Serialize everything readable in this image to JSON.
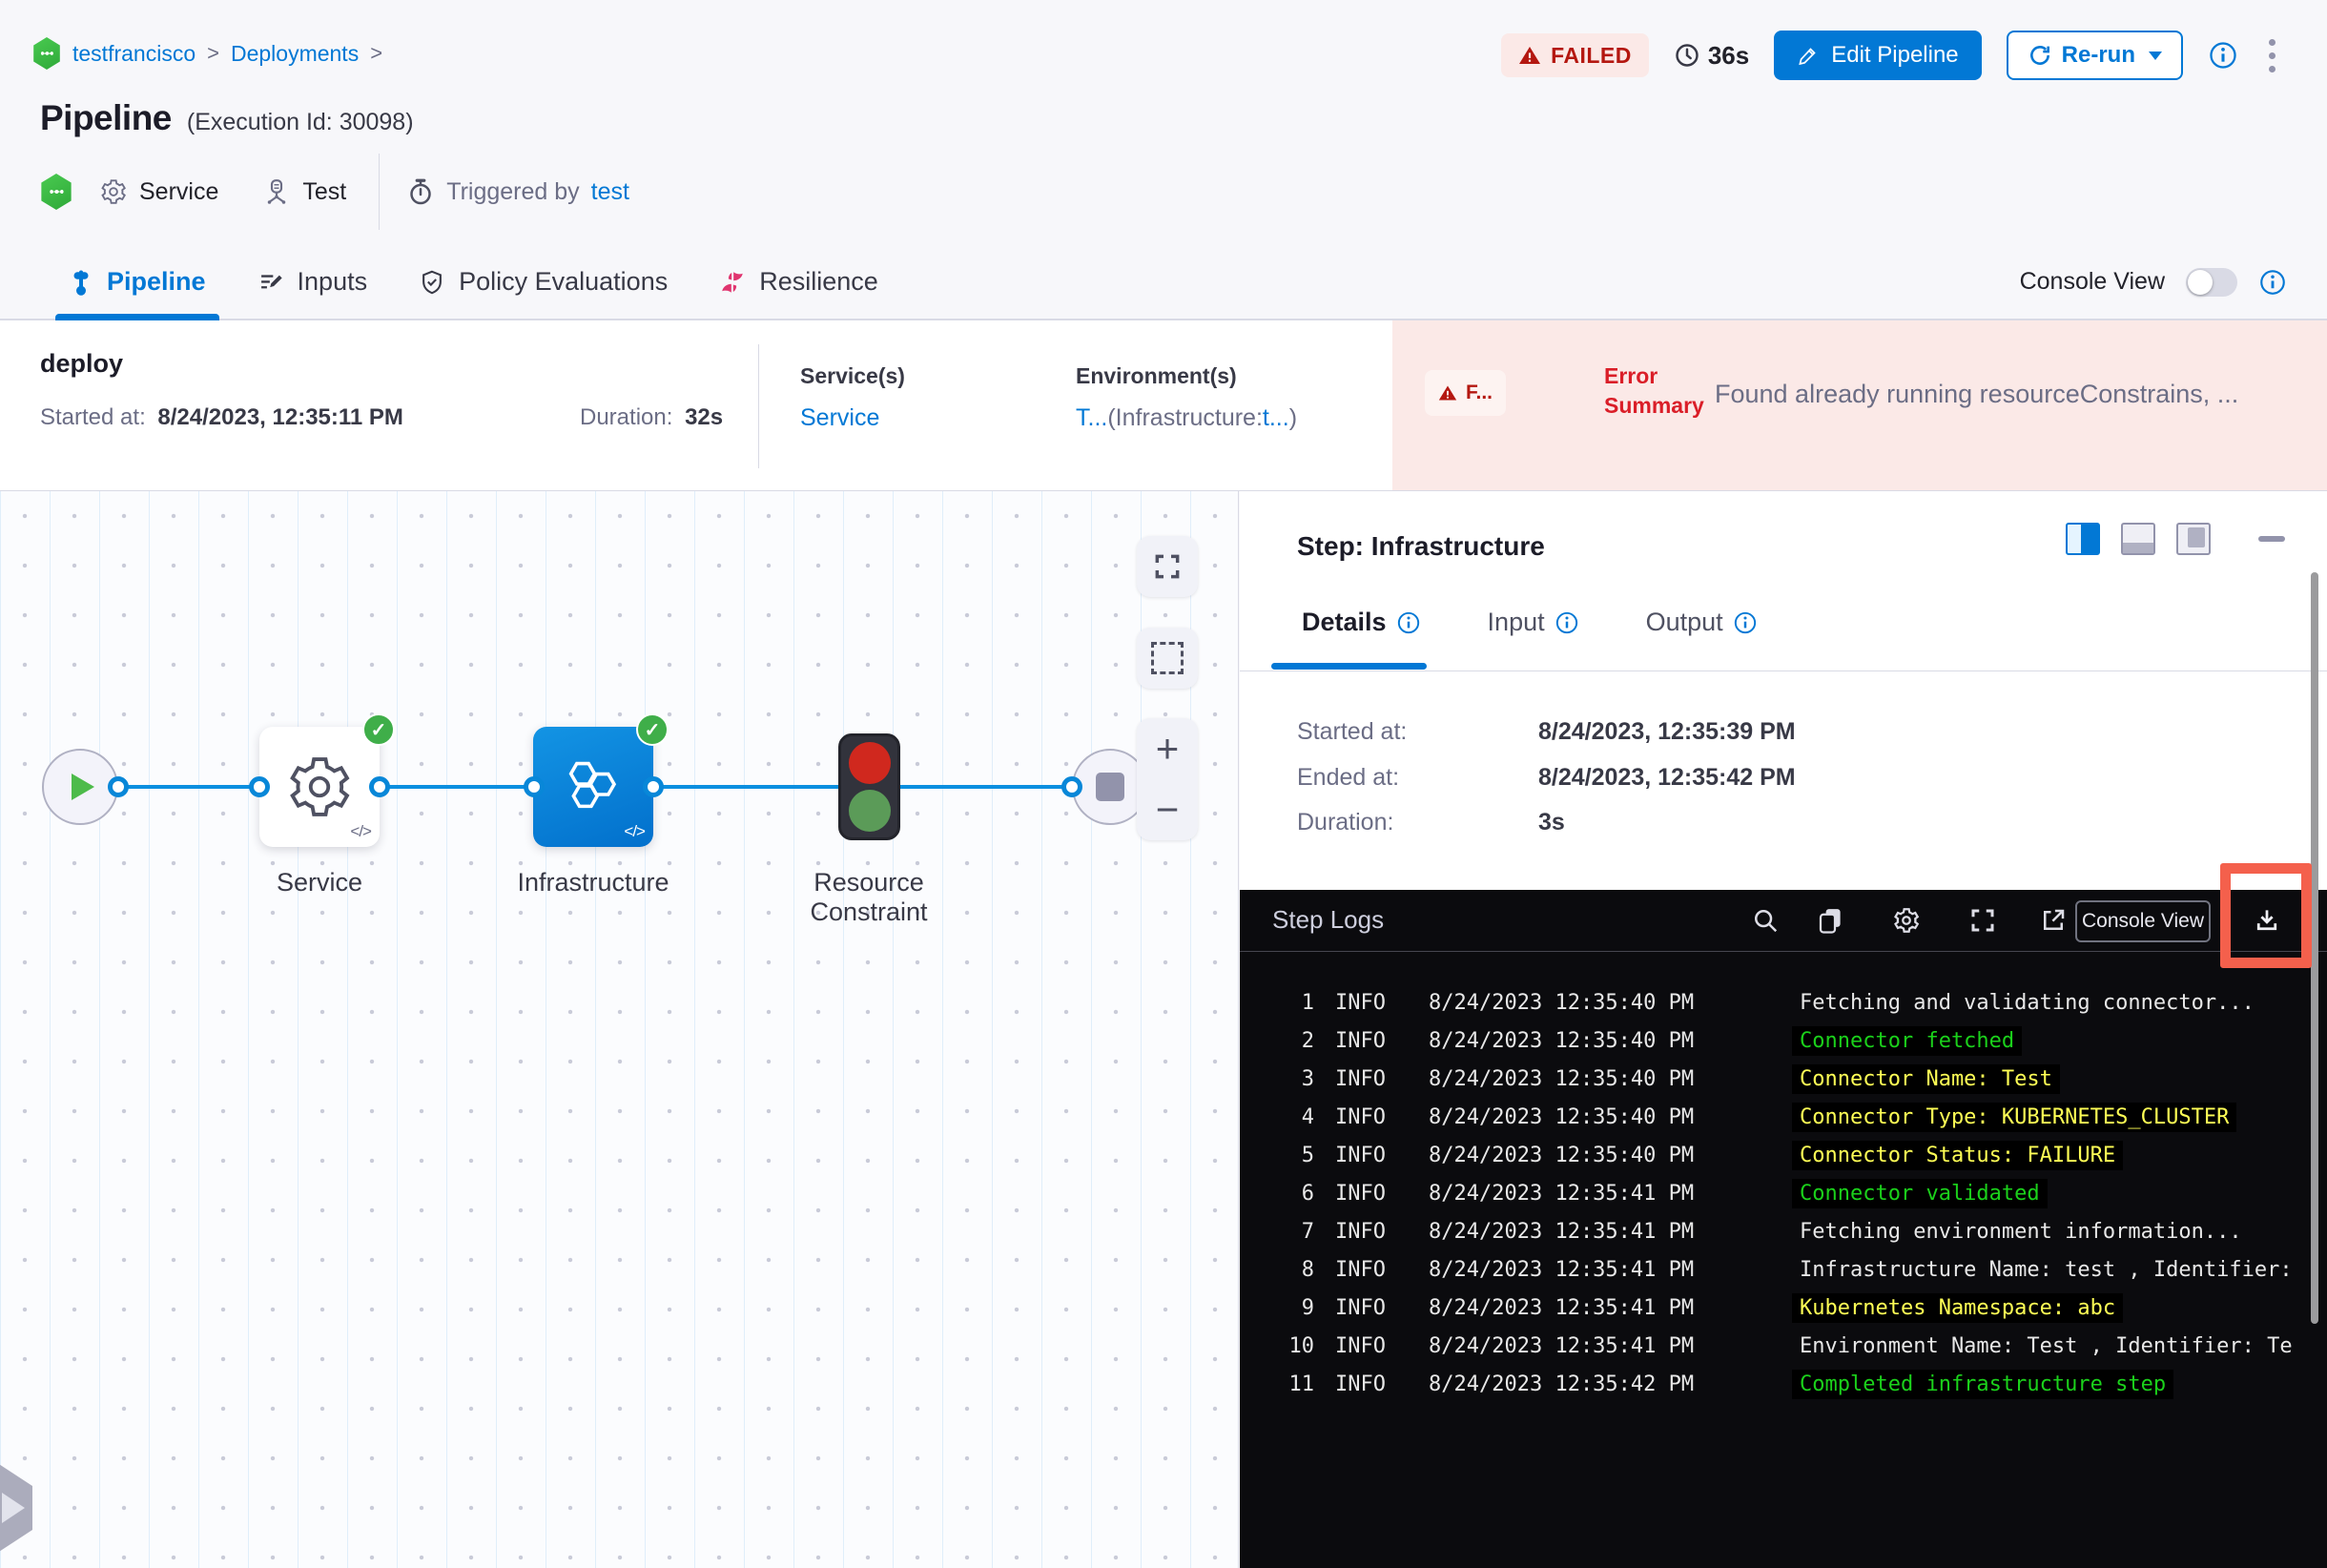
{
  "header": {
    "breadcrumb": {
      "item1": "testfrancisco",
      "item2": "Deployments",
      "separator": ">"
    },
    "title": "Pipeline",
    "execution_id": "(Execution Id: 30098)",
    "status_badge": "FAILED",
    "elapsed": "36s",
    "edit_pipeline_label": "Edit Pipeline",
    "rerun_label": "Re-run",
    "meta": {
      "service_label": "Service",
      "test_label": "Test",
      "triggered_by_label": "Triggered by",
      "triggered_by_value": "test"
    }
  },
  "tabbar": {
    "tabs": [
      {
        "label": "Pipeline"
      },
      {
        "label": "Inputs"
      },
      {
        "label": "Policy Evaluations"
      },
      {
        "label": "Resilience"
      }
    ],
    "console_view_label": "Console View"
  },
  "stage": {
    "name": "deploy",
    "started_label": "Started at:",
    "started_value": "8/24/2023, 12:35:11 PM",
    "duration_label": "Duration:",
    "duration_value": "32s",
    "services_label": "Service(s)",
    "service_value": "Service",
    "environments_label": "Environment(s)",
    "env_link1": "T...",
    "env_mid": "(Infrastructure:",
    "env_link2": "t...",
    "env_close": ")",
    "error_badge": "F...",
    "error_label": "Error Summary",
    "error_message": "Found already running resourceConstrains, ..."
  },
  "graph": {
    "code_glyph": "</>",
    "zoom_in": "+",
    "zoom_out": "−",
    "nodes": [
      {
        "label": "Service"
      },
      {
        "label": "Infrastructure"
      },
      {
        "label1": "Resource",
        "label2": "Constraint"
      }
    ]
  },
  "panel": {
    "title": "Step: Infrastructure",
    "tabs": [
      {
        "label": "Details"
      },
      {
        "label": "Input"
      },
      {
        "label": "Output"
      }
    ],
    "details": {
      "rows": [
        {
          "label": "Started at:",
          "value": "8/24/2023, 12:35:39 PM"
        },
        {
          "label": "Ended at:",
          "value": "8/24/2023, 12:35:42 PM"
        },
        {
          "label": "Duration:",
          "value": "3s"
        }
      ]
    }
  },
  "console": {
    "title": "Step Logs",
    "console_view_label": "Console View",
    "lines": [
      {
        "n": "1",
        "lvl": "INFO",
        "t": "8/24/2023 12:35:40 PM",
        "msg": "Fetching and validating connector...",
        "c": "w"
      },
      {
        "n": "2",
        "lvl": "INFO",
        "t": "8/24/2023 12:35:40 PM",
        "msg": "Connector fetched",
        "c": "g"
      },
      {
        "n": "3",
        "lvl": "INFO",
        "t": "8/24/2023 12:35:40 PM",
        "msg": "Connector Name: Test",
        "c": "y"
      },
      {
        "n": "4",
        "lvl": "INFO",
        "t": "8/24/2023 12:35:40 PM",
        "msg": "Connector Type: KUBERNETES_CLUSTER",
        "c": "y"
      },
      {
        "n": "5",
        "lvl": "INFO",
        "t": "8/24/2023 12:35:40 PM",
        "msg": "Connector Status: FAILURE",
        "c": "y"
      },
      {
        "n": "6",
        "lvl": "INFO",
        "t": "8/24/2023 12:35:41 PM",
        "msg": "Connector validated",
        "c": "g"
      },
      {
        "n": "7",
        "lvl": "INFO",
        "t": "8/24/2023 12:35:41 PM",
        "msg": "Fetching environment information...",
        "c": "w"
      },
      {
        "n": "8",
        "lvl": "INFO",
        "t": "8/24/2023 12:35:41 PM",
        "msg": "Infrastructure Name: test , Identifier:",
        "c": "w"
      },
      {
        "n": "9",
        "lvl": "INFO",
        "t": "8/24/2023 12:35:41 PM",
        "msg": "Kubernetes Namespace: abc",
        "c": "y"
      },
      {
        "n": "10",
        "lvl": "INFO",
        "t": "8/24/2023 12:35:41 PM",
        "msg": "Environment Name: Test , Identifier: Te",
        "c": "w"
      },
      {
        "n": "11",
        "lvl": "INFO",
        "t": "8/24/2023 12:35:42 PM",
        "msg": "Completed infrastructure step",
        "c": "g"
      }
    ]
  }
}
